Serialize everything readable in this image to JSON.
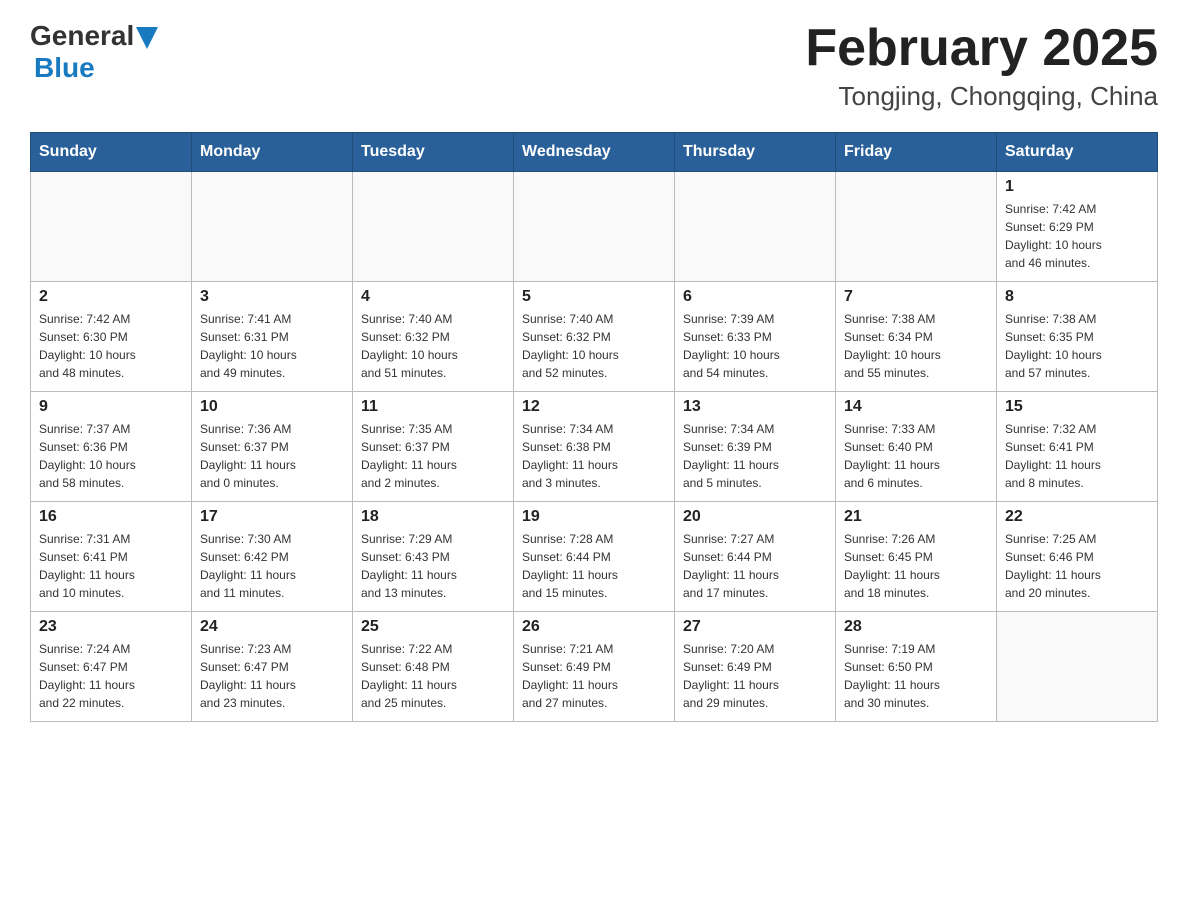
{
  "header": {
    "logo_general": "General",
    "logo_blue": "Blue",
    "title": "February 2025",
    "subtitle": "Tongjing, Chongqing, China"
  },
  "weekdays": [
    "Sunday",
    "Monday",
    "Tuesday",
    "Wednesday",
    "Thursday",
    "Friday",
    "Saturday"
  ],
  "weeks": [
    [
      {
        "day": "",
        "info": ""
      },
      {
        "day": "",
        "info": ""
      },
      {
        "day": "",
        "info": ""
      },
      {
        "day": "",
        "info": ""
      },
      {
        "day": "",
        "info": ""
      },
      {
        "day": "",
        "info": ""
      },
      {
        "day": "1",
        "info": "Sunrise: 7:42 AM\nSunset: 6:29 PM\nDaylight: 10 hours\nand 46 minutes."
      }
    ],
    [
      {
        "day": "2",
        "info": "Sunrise: 7:42 AM\nSunset: 6:30 PM\nDaylight: 10 hours\nand 48 minutes."
      },
      {
        "day": "3",
        "info": "Sunrise: 7:41 AM\nSunset: 6:31 PM\nDaylight: 10 hours\nand 49 minutes."
      },
      {
        "day": "4",
        "info": "Sunrise: 7:40 AM\nSunset: 6:32 PM\nDaylight: 10 hours\nand 51 minutes."
      },
      {
        "day": "5",
        "info": "Sunrise: 7:40 AM\nSunset: 6:32 PM\nDaylight: 10 hours\nand 52 minutes."
      },
      {
        "day": "6",
        "info": "Sunrise: 7:39 AM\nSunset: 6:33 PM\nDaylight: 10 hours\nand 54 minutes."
      },
      {
        "day": "7",
        "info": "Sunrise: 7:38 AM\nSunset: 6:34 PM\nDaylight: 10 hours\nand 55 minutes."
      },
      {
        "day": "8",
        "info": "Sunrise: 7:38 AM\nSunset: 6:35 PM\nDaylight: 10 hours\nand 57 minutes."
      }
    ],
    [
      {
        "day": "9",
        "info": "Sunrise: 7:37 AM\nSunset: 6:36 PM\nDaylight: 10 hours\nand 58 minutes."
      },
      {
        "day": "10",
        "info": "Sunrise: 7:36 AM\nSunset: 6:37 PM\nDaylight: 11 hours\nand 0 minutes."
      },
      {
        "day": "11",
        "info": "Sunrise: 7:35 AM\nSunset: 6:37 PM\nDaylight: 11 hours\nand 2 minutes."
      },
      {
        "day": "12",
        "info": "Sunrise: 7:34 AM\nSunset: 6:38 PM\nDaylight: 11 hours\nand 3 minutes."
      },
      {
        "day": "13",
        "info": "Sunrise: 7:34 AM\nSunset: 6:39 PM\nDaylight: 11 hours\nand 5 minutes."
      },
      {
        "day": "14",
        "info": "Sunrise: 7:33 AM\nSunset: 6:40 PM\nDaylight: 11 hours\nand 6 minutes."
      },
      {
        "day": "15",
        "info": "Sunrise: 7:32 AM\nSunset: 6:41 PM\nDaylight: 11 hours\nand 8 minutes."
      }
    ],
    [
      {
        "day": "16",
        "info": "Sunrise: 7:31 AM\nSunset: 6:41 PM\nDaylight: 11 hours\nand 10 minutes."
      },
      {
        "day": "17",
        "info": "Sunrise: 7:30 AM\nSunset: 6:42 PM\nDaylight: 11 hours\nand 11 minutes."
      },
      {
        "day": "18",
        "info": "Sunrise: 7:29 AM\nSunset: 6:43 PM\nDaylight: 11 hours\nand 13 minutes."
      },
      {
        "day": "19",
        "info": "Sunrise: 7:28 AM\nSunset: 6:44 PM\nDaylight: 11 hours\nand 15 minutes."
      },
      {
        "day": "20",
        "info": "Sunrise: 7:27 AM\nSunset: 6:44 PM\nDaylight: 11 hours\nand 17 minutes."
      },
      {
        "day": "21",
        "info": "Sunrise: 7:26 AM\nSunset: 6:45 PM\nDaylight: 11 hours\nand 18 minutes."
      },
      {
        "day": "22",
        "info": "Sunrise: 7:25 AM\nSunset: 6:46 PM\nDaylight: 11 hours\nand 20 minutes."
      }
    ],
    [
      {
        "day": "23",
        "info": "Sunrise: 7:24 AM\nSunset: 6:47 PM\nDaylight: 11 hours\nand 22 minutes."
      },
      {
        "day": "24",
        "info": "Sunrise: 7:23 AM\nSunset: 6:47 PM\nDaylight: 11 hours\nand 23 minutes."
      },
      {
        "day": "25",
        "info": "Sunrise: 7:22 AM\nSunset: 6:48 PM\nDaylight: 11 hours\nand 25 minutes."
      },
      {
        "day": "26",
        "info": "Sunrise: 7:21 AM\nSunset: 6:49 PM\nDaylight: 11 hours\nand 27 minutes."
      },
      {
        "day": "27",
        "info": "Sunrise: 7:20 AM\nSunset: 6:49 PM\nDaylight: 11 hours\nand 29 minutes."
      },
      {
        "day": "28",
        "info": "Sunrise: 7:19 AM\nSunset: 6:50 PM\nDaylight: 11 hours\nand 30 minutes."
      },
      {
        "day": "",
        "info": ""
      }
    ]
  ]
}
